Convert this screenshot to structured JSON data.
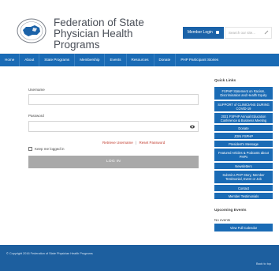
{
  "org": {
    "name": "Federation of State Physician Health Programs"
  },
  "header": {
    "member_login": "Member Login",
    "search_placeholder": "Search our site..."
  },
  "nav": [
    "Home",
    "About",
    "State Programs",
    "Membership",
    "Events",
    "Resources",
    "Donate",
    "PHP Participant Stories"
  ],
  "form": {
    "username_label": "Username",
    "password_label": "Password",
    "retrieve_username": "Retrieve Username",
    "reset_password": "Reset Password",
    "separator": "|",
    "keep_logged_in": "Keep me logged in",
    "login_button": "LOG IN"
  },
  "sidebar": {
    "quick_links_title": "Quick Links",
    "quick_links": [
      "FSPHP Statement on Racism, Discrimination and Health Equity",
      "SUPPORT of CLINICIANS DURING COVID-19",
      "2021 FSPHP Annual Education Conference & Business Meeting",
      "Donate",
      "JOIN FSPHP",
      "President's Message",
      "Featured Articles & Podcasts about PHPs",
      "Newsletters",
      "Submit a PHP Story, Member Testimonial, Event or Job",
      "Contact",
      "Member Testimonials"
    ],
    "upcoming_title": "Upcoming Events",
    "no_events": "No events",
    "view_calendar": "View Full Calendar"
  },
  "footer": {
    "copyright": "© Copyright 2016 Federation of State Physician Health Programs",
    "back_to_top": "Back to top"
  },
  "colors": {
    "nav_blue": "#1a6bb5",
    "footer_blue": "#1d5f9f",
    "link_red": "#c0392b",
    "login_gray": "#a9a9a9"
  }
}
